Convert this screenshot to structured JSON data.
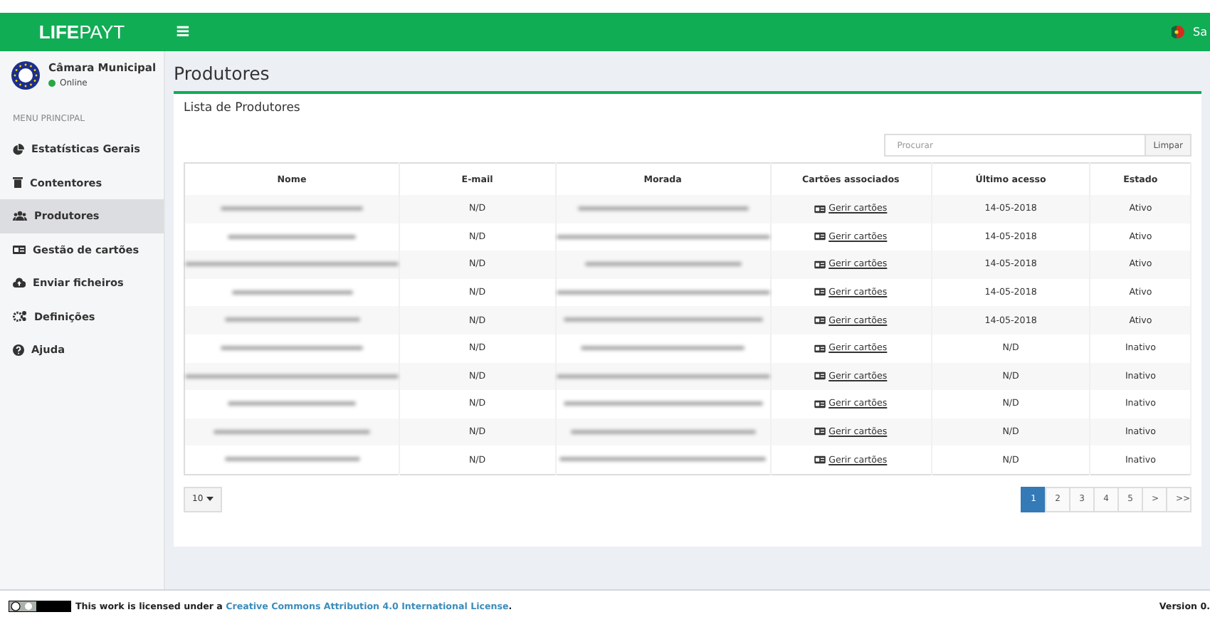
{
  "topbar": {
    "brand_bold": "LIFE",
    "brand_light": "PAYT",
    "menu_glyph": "≡",
    "user_label": "Sa"
  },
  "sidebar": {
    "user": {
      "name": "Câmara Municipal",
      "status": "Online"
    },
    "section": "MENU PRINCIPAL",
    "items": [
      {
        "label": "Estatísticas Gerais",
        "selected": false
      },
      {
        "label": "Contentores",
        "selected": false
      },
      {
        "label": "Produtores",
        "selected": true
      },
      {
        "label": "Gestão de cartões",
        "selected": false
      },
      {
        "label": "Enviar ficheiros",
        "selected": false
      },
      {
        "label": "Definições",
        "selected": false
      },
      {
        "label": "Ajuda",
        "selected": false
      }
    ]
  },
  "page_title": "Produtores",
  "box_title": "Lista de Produtores",
  "search": {
    "placeholder": "Procurar",
    "button": "Limpar"
  },
  "table": {
    "columns": [
      "Nome",
      "E-mail",
      "Morada",
      "Cartões associados",
      "Último acesso",
      "Estado"
    ],
    "rows": [
      {
        "email": "N/D",
        "cards_link": "Gerir cartões",
        "last_access": "14-05-2018",
        "status": "Ativo"
      },
      {
        "email": "N/D",
        "cards_link": "Gerir cartões",
        "last_access": "14-05-2018",
        "status": "Ativo"
      },
      {
        "email": "N/D",
        "cards_link": "Gerir cartões",
        "last_access": "14-05-2018",
        "status": "Ativo"
      },
      {
        "email": "N/D",
        "cards_link": "Gerir cartões",
        "last_access": "14-05-2018",
        "status": "Ativo"
      },
      {
        "email": "N/D",
        "cards_link": "Gerir cartões",
        "last_access": "14-05-2018",
        "status": "Ativo"
      },
      {
        "email": "N/D",
        "cards_link": "Gerir cartões",
        "last_access": "N/D",
        "status": "Inativo"
      },
      {
        "email": "N/D",
        "cards_link": "Gerir cartões",
        "last_access": "N/D",
        "status": "Inativo"
      },
      {
        "email": "N/D",
        "cards_link": "Gerir cartões",
        "last_access": "N/D",
        "status": "Inativo"
      },
      {
        "email": "N/D",
        "cards_link": "Gerir cartões",
        "last_access": "N/D",
        "status": "Inativo"
      },
      {
        "email": "N/D",
        "cards_link": "Gerir cartões",
        "last_access": "N/D",
        "status": "Inativo"
      }
    ]
  },
  "page_size": "10",
  "pagination": [
    {
      "label": "1",
      "selected": true
    },
    {
      "label": "2",
      "selected": false
    },
    {
      "label": "3",
      "selected": false
    },
    {
      "label": "4",
      "selected": false
    },
    {
      "label": "5",
      "selected": false
    },
    {
      "label": ">",
      "selected": false
    },
    {
      "label": ">>",
      "selected": false
    }
  ],
  "footer": {
    "license_text": "This work is licensed under a ",
    "license_link": "Creative Commons Attribution 4.0 International License",
    "license_end": ".",
    "version": "Version 0."
  }
}
